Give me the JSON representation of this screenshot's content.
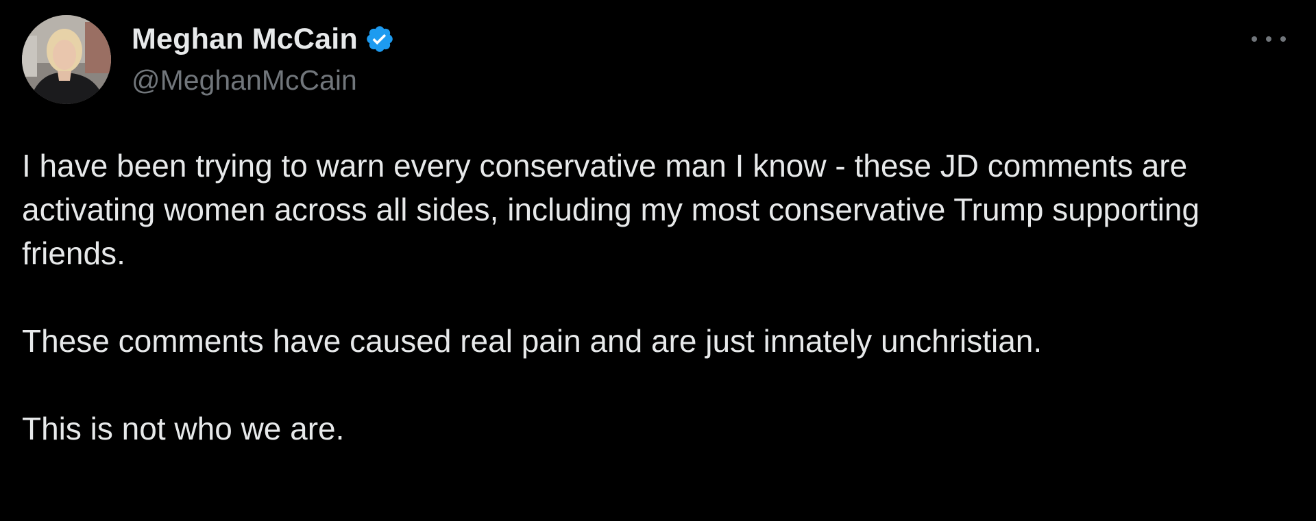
{
  "author": {
    "display_name": "Meghan McCain",
    "handle": "@MeghanMcCain",
    "verified": true,
    "verified_color": "#1d9bf0"
  },
  "icons": {
    "avatar": "profile-photo",
    "verified": "verified-badge-icon",
    "more": "more-options-icon"
  },
  "tweet": {
    "paragraphs": [
      "I have been trying to warn every conservative man I know - these JD comments are activating women across all sides, including my most conservative Trump supporting friends.",
      "These comments have caused real pain and are just innately unchristian.",
      "This is not who we are."
    ]
  },
  "colors": {
    "background": "#000000",
    "text": "#e7e9ea",
    "secondary": "#71767b"
  }
}
